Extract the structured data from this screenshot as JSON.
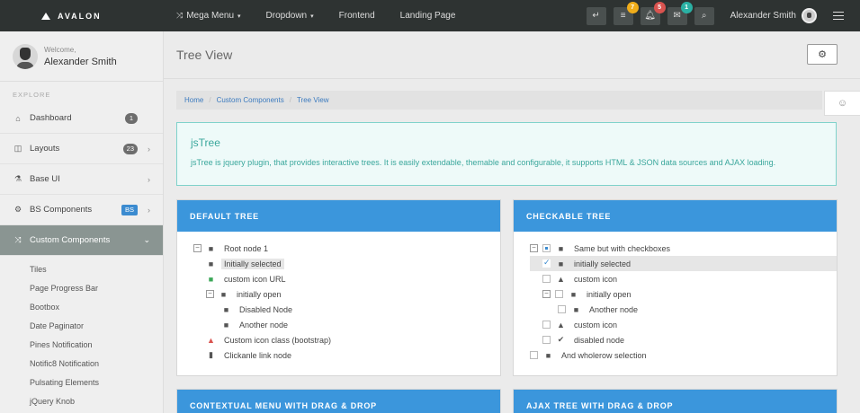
{
  "brand": {
    "name": "AVALON"
  },
  "topnav": {
    "items": [
      {
        "label": "Mega Menu",
        "has_caret": true,
        "icon": "shuffle-icon"
      },
      {
        "label": "Dropdown",
        "has_caret": true
      },
      {
        "label": "Frontend"
      },
      {
        "label": "Landing Page"
      }
    ],
    "buttons": [
      {
        "icon": "return-icon",
        "badge": ""
      },
      {
        "icon": "list-icon",
        "badge": "7",
        "badge_color": "#f0ad1a"
      },
      {
        "icon": "bell-icon",
        "badge": "5",
        "badge_color": "#d9534f"
      },
      {
        "icon": "envelope-icon",
        "badge": "1",
        "badge_color": "#2ab1a4"
      },
      {
        "icon": "search-icon",
        "badge": ""
      }
    ],
    "username": "Alexander Smith"
  },
  "sidebar": {
    "welcome": "Welcome,",
    "name": "Alexander Smith",
    "section": "EXPLORE",
    "items": [
      {
        "label": "Dashboard",
        "icon": "home-icon",
        "badge": "1"
      },
      {
        "label": "Layouts",
        "icon": "columns-icon",
        "badge": "23",
        "chevron": "›"
      },
      {
        "label": "Base UI",
        "icon": "flask-icon",
        "chevron": "›"
      },
      {
        "label": "BS Components",
        "icon": "cogs-icon",
        "badge": "BS",
        "chevron": "›"
      },
      {
        "label": "Custom Components",
        "icon": "shuffle-icon",
        "chevron": "⌄"
      }
    ],
    "subitems": [
      "Tiles",
      "Page Progress Bar",
      "Bootbox",
      "Date Paginator",
      "Pines Notification",
      "Notific8 Notification",
      "Pulsating Elements",
      "jQuery Knob"
    ]
  },
  "page": {
    "title": "Tree View",
    "breadcrumb": [
      "Home",
      "Custom Components",
      "Tree View"
    ],
    "info_title": "jsTree",
    "info_text": "jsTree is jquery plugin, that provides interactive trees. It is easily extendable, themable and configurable, it supports HTML & JSON data sources and AJAX loading."
  },
  "panels": {
    "default_tree": {
      "title": "DEFAULT TREE",
      "nodes": [
        "Root node 1",
        "Initially selected",
        "custom icon URL",
        "initially open",
        "Disabled Node",
        "Another node",
        "Custom icon class (bootstrap)",
        "Clickanle link node"
      ]
    },
    "checkable_tree": {
      "title": "CHECKABLE TREE",
      "nodes": [
        "Same but with checkboxes",
        "initially selected",
        "custom icon",
        "initially open",
        "Another node",
        "custom icon",
        "disabled node",
        "And wholerow selection"
      ]
    },
    "context_menu": {
      "title": "CONTEXTUAL MENU WITH DRAG & DROP"
    },
    "ajax_tree": {
      "title": "AJAX TREE WITH DRAG & DROP"
    }
  }
}
